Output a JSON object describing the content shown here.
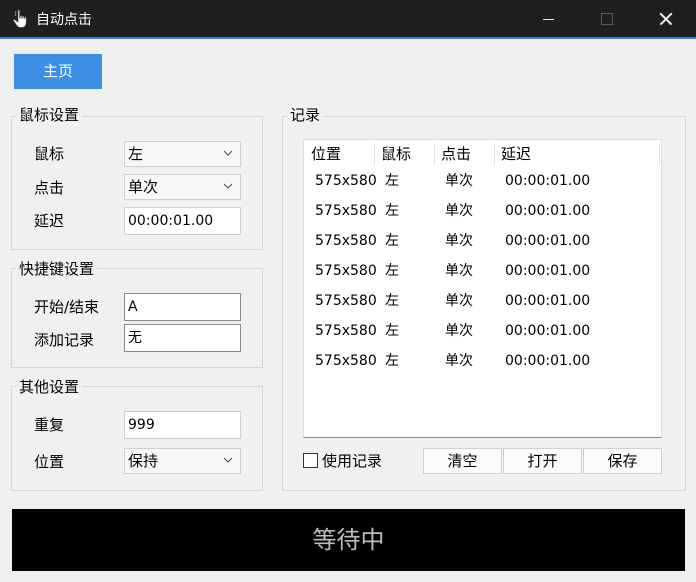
{
  "window": {
    "title": "自动点击",
    "icons": {
      "app": "hand-pointer-icon",
      "minimize": "minimize-icon",
      "maximize": "maximize-icon",
      "close": "close-icon"
    },
    "accent_color": "#3c7dd9"
  },
  "toolbar": {
    "home_label": "主页",
    "home_color": "#3d8ee5"
  },
  "mouse_settings": {
    "title": "鼠标设置",
    "button_label": "鼠标",
    "button_value": "左",
    "click_label": "点击",
    "click_value": "单次",
    "delay_label": "延迟",
    "delay_value": "00:00:01.00"
  },
  "hotkey_settings": {
    "title": "快捷键设置",
    "start_stop_label": "开始/结束",
    "start_stop_value": "A",
    "add_record_label": "添加记录",
    "add_record_value": "无"
  },
  "other_settings": {
    "title": "其他设置",
    "repeat_label": "重复",
    "repeat_value": "999",
    "position_label": "位置",
    "position_value": "保持"
  },
  "records": {
    "title": "记录",
    "columns": [
      "位置",
      "鼠标",
      "点击",
      "延迟"
    ],
    "rows": [
      [
        "575x580",
        "左",
        "单次",
        "00:00:01.00"
      ],
      [
        "575x580",
        "左",
        "单次",
        "00:00:01.00"
      ],
      [
        "575x580",
        "左",
        "单次",
        "00:00:01.00"
      ],
      [
        "575x580",
        "左",
        "单次",
        "00:00:01.00"
      ],
      [
        "575x580",
        "左",
        "单次",
        "00:00:01.00"
      ],
      [
        "575x580",
        "左",
        "单次",
        "00:00:01.00"
      ],
      [
        "575x580",
        "左",
        "单次",
        "00:00:01.00"
      ]
    ],
    "use_records_label": "使用记录",
    "use_records_checked": false,
    "clear_label": "清空",
    "open_label": "打开",
    "save_label": "保存"
  },
  "status": {
    "text": "等待中"
  }
}
